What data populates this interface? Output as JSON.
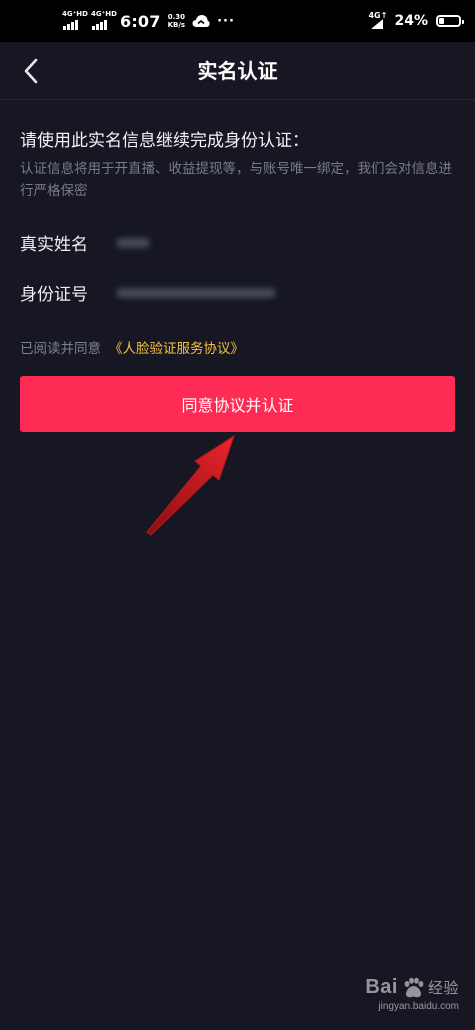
{
  "status_bar": {
    "sim1_label": "4G⁺HD",
    "sim2_label": "4G⁺HD",
    "time": "6:07",
    "speed_value": "0.30",
    "speed_unit": "KB/s",
    "overflow": "···",
    "network_label": "4G↑",
    "battery_percent": "24%",
    "battery_level": 0.24
  },
  "nav": {
    "title": "实名认证"
  },
  "content": {
    "heading": "请使用此实名信息继续完成身份认证：",
    "description": "认证信息将用于开直播、收益提现等，与账号唯一绑定，我们会对信息进行严格保密",
    "fields": [
      {
        "label": "真实姓名"
      },
      {
        "label": "身份证号"
      }
    ],
    "agreement_prefix": "已阅读并同意",
    "agreement_link": "《人脸验证服务协议》",
    "submit_button": "同意协议并认证"
  },
  "watermark": {
    "brand": "Bai",
    "brand_suffix": "经验",
    "url": "jingyan.baidu.com"
  },
  "colors": {
    "background": "#161722",
    "accent": "#fe2c55",
    "link": "#f3c142"
  }
}
